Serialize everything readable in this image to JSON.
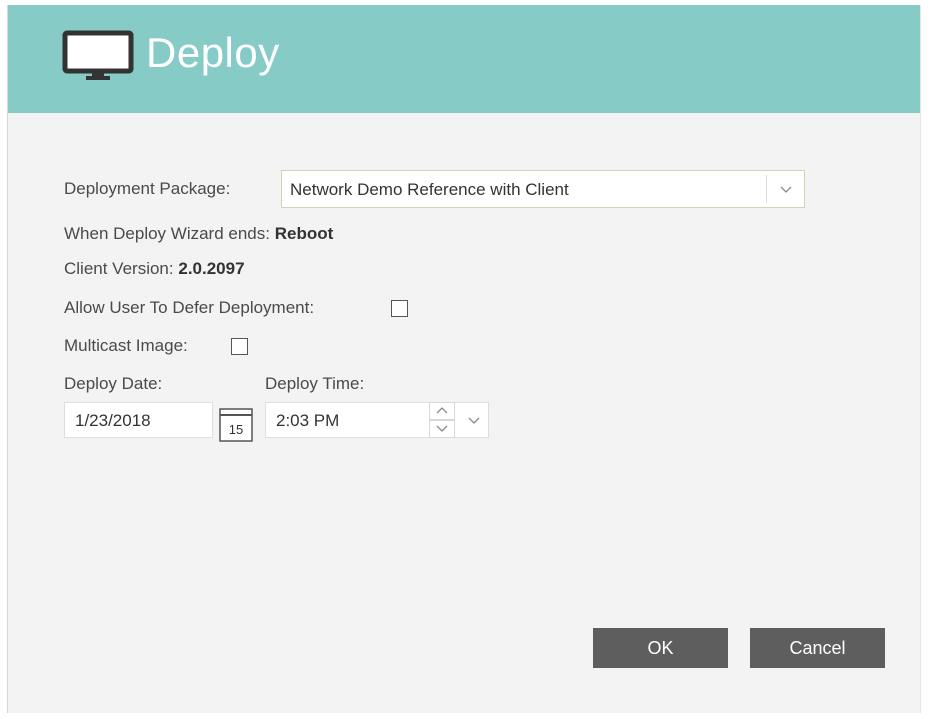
{
  "header": {
    "title": "Deploy",
    "icon": "monitor-icon"
  },
  "form": {
    "package_label": "Deployment Package:",
    "package_value": "Network Demo Reference with Client",
    "wizard_ends_label": "When Deploy Wizard ends:",
    "wizard_ends_value": "Reboot",
    "client_version_label": "Client Version:",
    "client_version_value": "2.0.2097",
    "allow_defer_label": "Allow User To Defer Deployment:",
    "allow_defer_checked": false,
    "multicast_label": "Multicast Image:",
    "multicast_checked": false,
    "deploy_date_label": "Deploy Date:",
    "deploy_date_value": "1/23/2018",
    "calendar_icon_text": "15",
    "deploy_time_label": "Deploy Time:",
    "deploy_time_value": "2:03 PM"
  },
  "buttons": {
    "ok_label": "OK",
    "cancel_label": "Cancel"
  },
  "colors": {
    "header_bg": "#86cbc6",
    "button_bg": "#5e5e5e",
    "body_bg": "#f3f3f3"
  }
}
